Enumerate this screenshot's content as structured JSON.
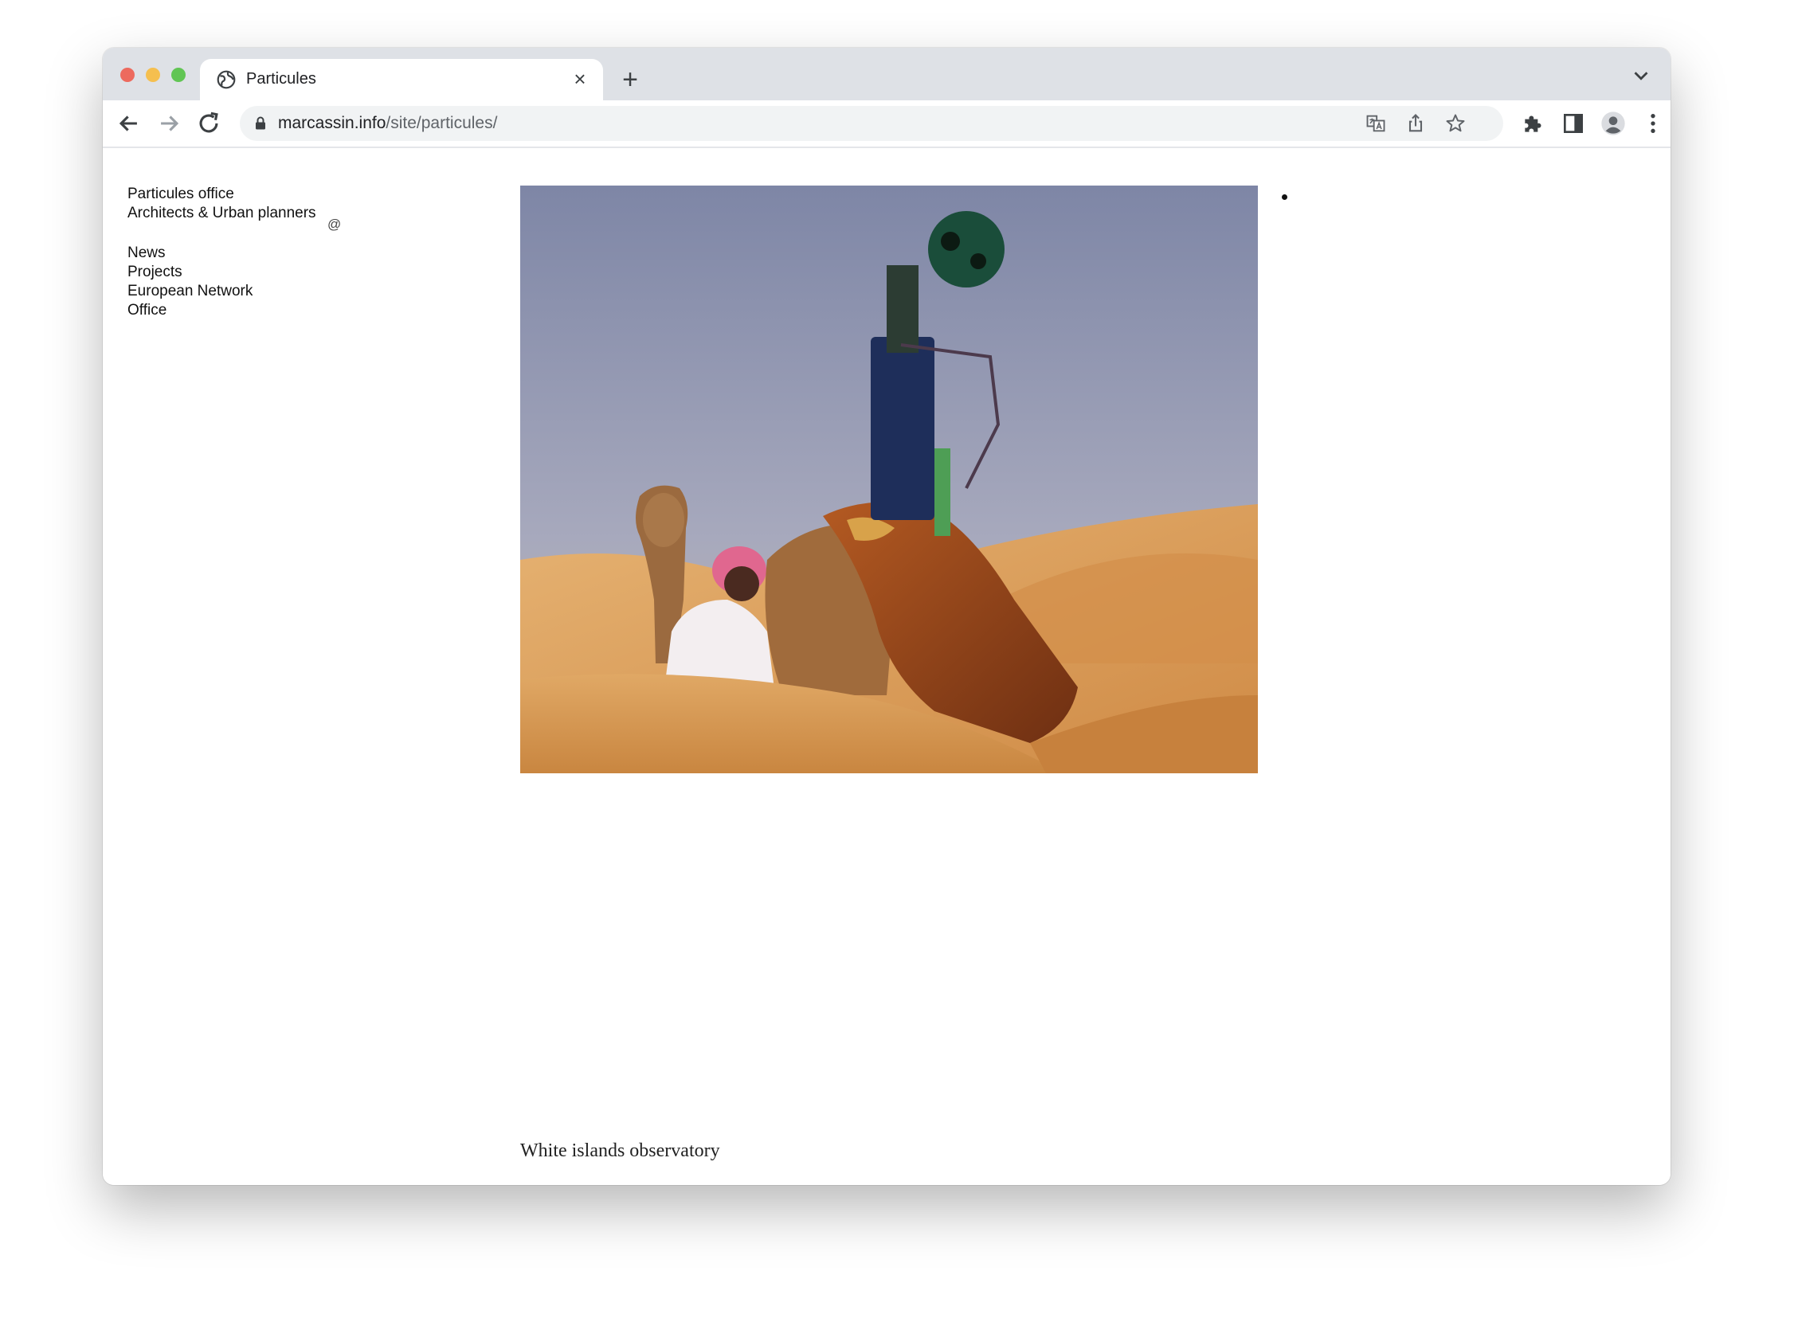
{
  "browser": {
    "tab_title": "Particules",
    "new_tab_symbol": "+",
    "close_symbol": "×",
    "url_host": "marcassin.info",
    "url_path": "/site/particules/",
    "icons": {
      "tab_favicon": "globe-icon",
      "back": "arrow-left-icon",
      "forward": "arrow-right-icon",
      "reload": "reload-icon",
      "lock": "lock-icon",
      "translate": "translate-icon",
      "share": "share-icon",
      "bookmark": "star-icon",
      "extensions": "puzzle-icon",
      "side_panel": "side-panel-icon",
      "profile": "profile-icon",
      "menu": "kebab-menu-icon",
      "tab_search": "chevron-down-icon"
    }
  },
  "site": {
    "brand_line1": "Particules office",
    "brand_line2": "Architects & Urban planners",
    "nav": [
      "News",
      "Projects",
      "European Network",
      "Office"
    ],
    "contact_symbol": "@",
    "caption": "White islands observatory"
  },
  "colors": {
    "tabbar": "#dee1e6",
    "sky": "#8e94ad",
    "sand": "#d99a4f"
  }
}
